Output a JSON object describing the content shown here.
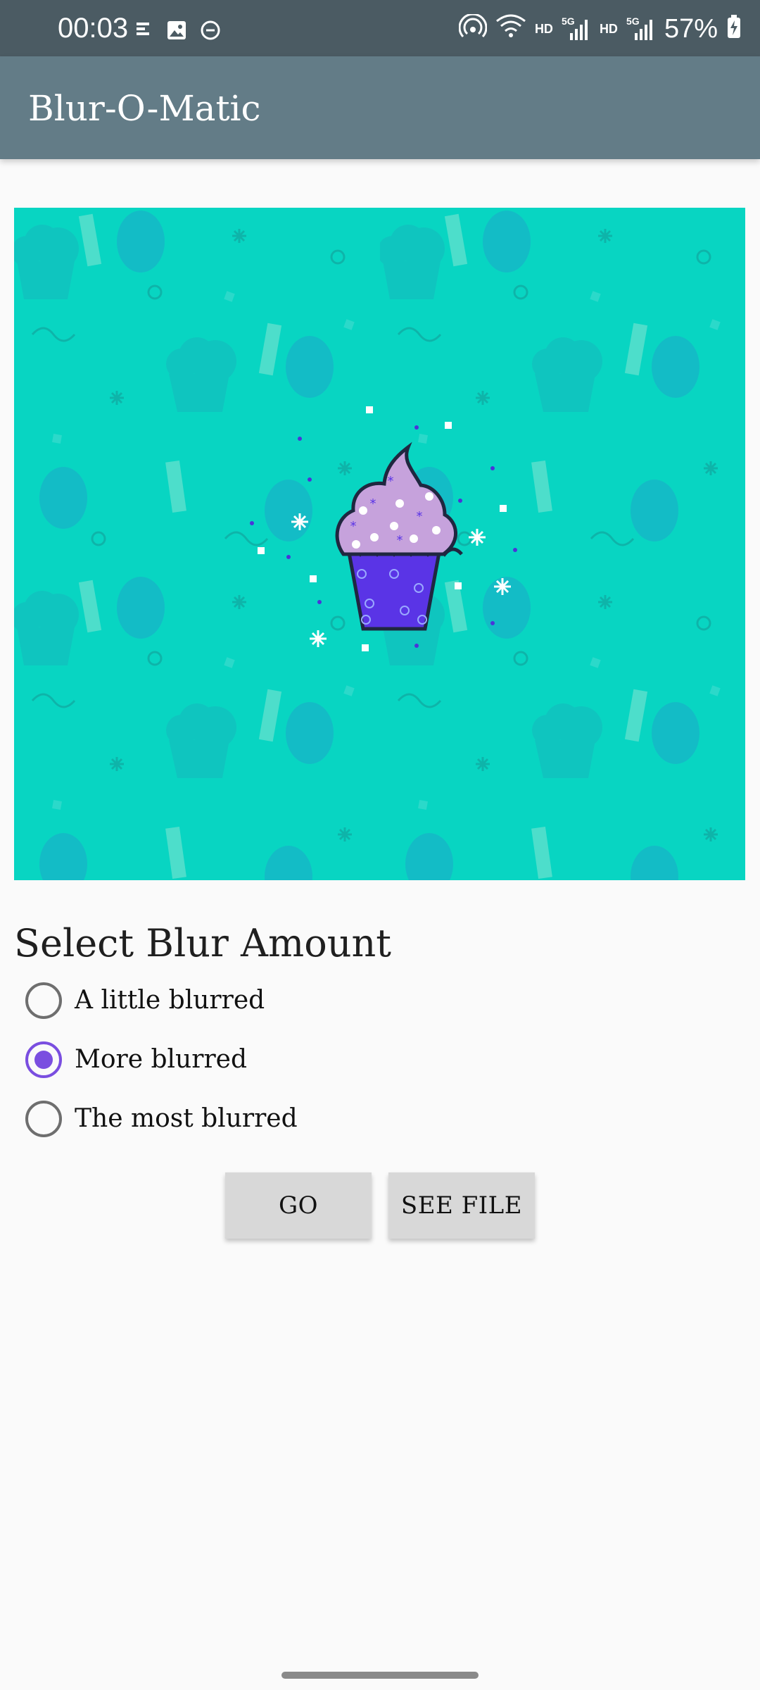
{
  "status_bar": {
    "time": "00:03",
    "network_labels": [
      "HD",
      "5G",
      "HD",
      "5G"
    ],
    "battery": "57%",
    "icons": [
      "notification-icon",
      "image-icon",
      "dnd-icon",
      "hotspot-icon",
      "wifi-icon",
      "signal-icon",
      "battery-icon"
    ]
  },
  "app": {
    "title": "Blur-O-Matic"
  },
  "hero": {
    "image_name": "cupcake-image",
    "background_color": "#08d5c2"
  },
  "blur": {
    "section_title": "Select Blur Amount",
    "options": [
      {
        "label": "A little blurred",
        "selected": false
      },
      {
        "label": "More blurred",
        "selected": true
      },
      {
        "label": "The most blurred",
        "selected": false
      }
    ]
  },
  "actions": {
    "go": "GO",
    "see_file": "SEE FILE"
  },
  "colors": {
    "accent": "#7a4ee0",
    "app_bar": "#637c87",
    "status_bar": "#4b5b63"
  }
}
